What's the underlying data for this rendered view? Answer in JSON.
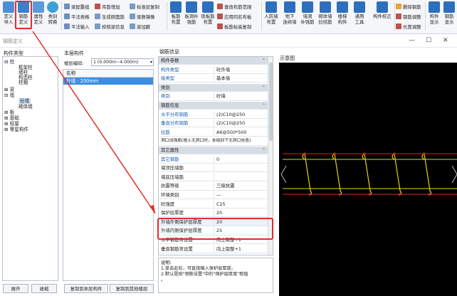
{
  "ribbon": {
    "left_buttons": [
      {
        "label_line1": "定义",
        "label_line2": "导入",
        "icon": "import-icon",
        "color": "#4a8fd8"
      },
      {
        "label_line1": "钢筋",
        "label_line2": "定义",
        "icon": "rebar-define-icon",
        "color": "#3b7fd4"
      },
      {
        "label_line1": "属性",
        "label_line2": "定义",
        "icon": "property-icon",
        "color": "#3b7fd4"
      },
      {
        "label_line1": "类别",
        "label_line2": "转换",
        "icon": "convert-icon",
        "color": "#3b7fd4"
      }
    ],
    "group1": [
      "梁配重组",
      "平法表格",
      "平法输入"
    ],
    "group2": [
      "吊筋增加",
      "生成侧面筋",
      "校核梁信息"
    ],
    "group3": [
      "标准层复制",
      "梁数镜像",
      "梁加腋"
    ],
    "group4_big": [
      {
        "l1": "板筋",
        "l2": "布置"
      },
      {
        "l1": "板洞补",
        "l2": "强筋"
      },
      {
        "l1": "现板筋",
        "l2": "布置"
      }
    ],
    "group5": [
      "查改布筋范围",
      "应用同名布板",
      "板筋标高复制"
    ],
    "group6_big": [
      {
        "l1": "人防墙",
        "l2": "布置"
      },
      {
        "l1": "地下",
        "l2": "连续墙"
      },
      {
        "l1": "墙洞",
        "l2": "补强筋"
      },
      {
        "l1": "砌体墙",
        "l2": "拉结筋"
      },
      {
        "l1": "楼梯",
        "l2": "构件"
      },
      {
        "l1": "通用",
        "l2": "工具"
      },
      {
        "l1": "构件校正",
        "l2": ""
      }
    ],
    "group7": [
      "删除钢筋",
      "钢筋调整",
      "长度调整"
    ],
    "group8_big": [
      {
        "l1": "构件",
        "l2": "显示"
      },
      {
        "l1": "钢筋",
        "l2": "显示"
      }
    ]
  },
  "dialog": {
    "title": "钢筋定义",
    "left_title": "构件类型",
    "tree": [
      {
        "text": "⊟ 柱",
        "indent": 0
      },
      {
        "text": "框架柱",
        "indent": 2
      },
      {
        "text": "墙柱",
        "indent": 2
      },
      {
        "text": "构造柱",
        "indent": 2
      },
      {
        "text": "柱帽",
        "indent": 2
      },
      {
        "text": "⊞ 梁",
        "indent": 0
      },
      {
        "text": "⊟ 墙",
        "indent": 0
      },
      {
        "text": "砼墙",
        "indent": 2,
        "selected": true
      },
      {
        "text": "砌体墙",
        "indent": 2
      },
      {
        "text": "⊞ 板",
        "indent": 0
      },
      {
        "text": "⊞ 基础",
        "indent": 0
      },
      {
        "text": "⊞ 轻量",
        "indent": 0
      },
      {
        "text": "⊞ 零星构件",
        "indent": 0
      }
    ],
    "btn_expand": "展开",
    "btn_collapse": "收缩",
    "mid_title": "本层构件",
    "elevation_label": "楼层编码:",
    "elevation_value": "1 (0.000m~4.000m)",
    "list_header": "名称",
    "list_items": [
      "外墙 - 200mm"
    ],
    "btn_copy_layer": "复制到本层构件",
    "btn_copy_other": "复制到其他楼层",
    "grid_title": "钢筋信息",
    "grid_rows": [
      {
        "k": "构件参数",
        "v": "",
        "type": "hdr"
      },
      {
        "k": "构件类型",
        "v": "砼外墙",
        "type": "blue"
      },
      {
        "k": "级类型",
        "v": "基本墙",
        "type": "blue"
      },
      {
        "k": "类别",
        "v": "",
        "type": "hdr"
      },
      {
        "k": "类别",
        "v": "砼墙",
        "type": "blue"
      },
      {
        "k": "钢筋信息",
        "v": "",
        "type": "hdr"
      },
      {
        "k": "水平分布钢筋",
        "v": "(2)C10@250",
        "type": "blue"
      },
      {
        "k": "垂直分布钢筋",
        "v": "(2)C10@250",
        "type": "blue"
      },
      {
        "k": "拉筋",
        "v": "A6@500*500",
        "type": "blue"
      },
      {
        "k": "洞口加强筋(墙上无洞口时，本组别下无洞口信息)",
        "v": "",
        "type": "note"
      },
      {
        "k": "其它属性",
        "v": "",
        "type": "hdr"
      },
      {
        "k": "其它钢筋",
        "v": "0",
        "type": "blue"
      },
      {
        "k": "墙顶压墙筋",
        "v": "",
        "type": "normal"
      },
      {
        "k": "墙底压墙筋",
        "v": "",
        "type": "normal"
      },
      {
        "k": "抗震等级",
        "v": "三级抗震",
        "type": "normal"
      },
      {
        "k": "环境类别",
        "v": "—",
        "type": "normal"
      },
      {
        "k": "砼强度",
        "v": "C25",
        "type": "normal"
      },
      {
        "k": "保护层厚度",
        "v": "20",
        "type": "normal"
      },
      {
        "k": "外墙外侧保护层厚度",
        "v": "20",
        "type": "sel"
      },
      {
        "k": "外墙内侧保护层厚度",
        "v": "25",
        "type": "normal"
      },
      {
        "k": "水平钢筋弯设置",
        "v": "向上取整+1",
        "type": "normal"
      },
      {
        "k": "垂直钢筋弯设置",
        "v": "向上取整+1",
        "type": "normal"
      }
    ],
    "hint_title": "说明:",
    "hint_lines": [
      "1.单击此栏，可直接输入保护层厚度。",
      "2.默认是按\"钢筋设置\"中的\"保护层厚度\"取值",
      "。"
    ],
    "preview_label": "示意图"
  },
  "window": {
    "min": "—",
    "max": "☐",
    "close": "✕"
  },
  "colors": {
    "highlight": "#e52b2b",
    "selection": "#3b8fe0",
    "header": "#d7dde5"
  }
}
